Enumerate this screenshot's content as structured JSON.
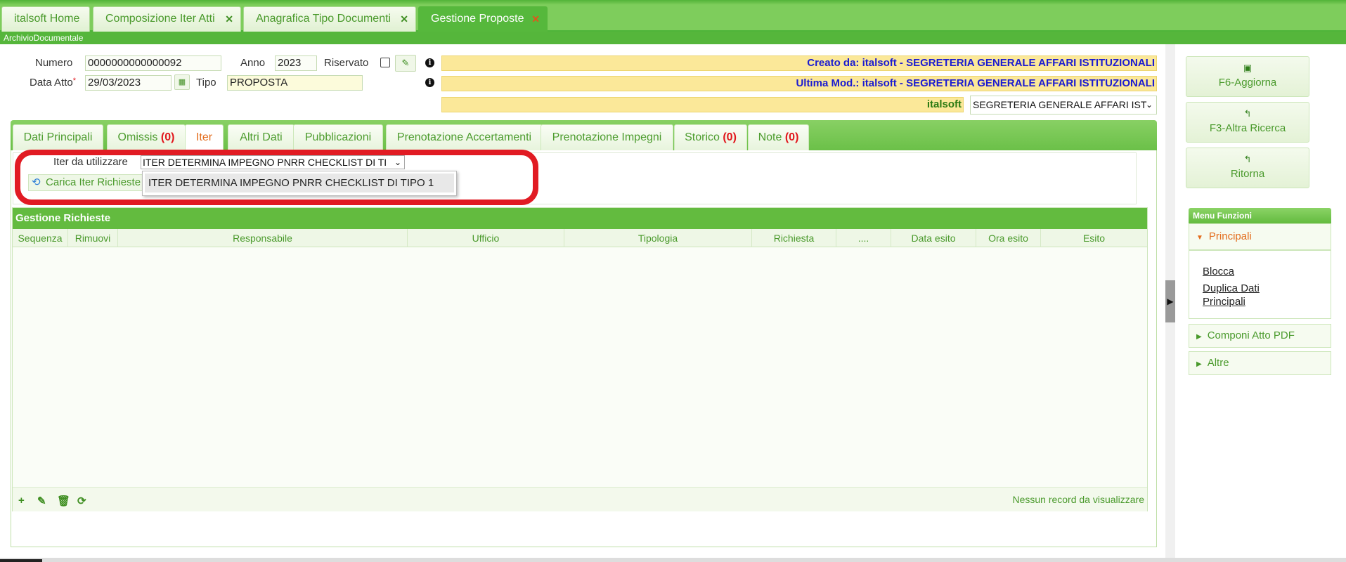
{
  "colors": {
    "accent": "#55b63b",
    "tab_active": "#56b83c",
    "count_red": "#e1151b",
    "highlight_ring": "#e11b23",
    "selected_tab": "#e36c1c"
  },
  "tabs": [
    {
      "label": "italsoft Home",
      "closable": false
    },
    {
      "label": "Composizione Iter Atti",
      "closable": true
    },
    {
      "label": "Anagrafica Tipo Documenti",
      "closable": true
    },
    {
      "label": "Gestione Proposte",
      "closable": true,
      "active": true
    }
  ],
  "close_glyph": "✕",
  "subbar": "ArchivioDocumentale",
  "form": {
    "numero_label": "Numero",
    "numero_value": "0000000000000092",
    "anno_label": "Anno",
    "anno_value": "2023",
    "riservato_label": "Riservato",
    "riservato_checked": false,
    "data_atto_label": "Data Atto",
    "required_mark": "*",
    "data_atto_value": "29/03/2023",
    "tipo_label": "Tipo",
    "tipo_value": "PROPOSTA"
  },
  "info_bars": {
    "created": "Creato da: italsoft - SEGRETERIA GENERALE AFFARI ISTITUZIONALI",
    "modified": "Ultima Mod.: italsoft - SEGRETERIA GENERALE AFFARI ISTITUZIONALI",
    "user": "italsoft",
    "office_select": "SEGRETERIA GENERALE AFFARI IST"
  },
  "inner_tabs": [
    {
      "label": "Dati Principali",
      "count": ""
    },
    {
      "label": "Omissis",
      "count": "(0)"
    },
    {
      "label": "Iter",
      "count": "",
      "selected": true
    },
    {
      "label": "Altri Dati",
      "count": ""
    },
    {
      "label": "Pubblicazioni",
      "count": ""
    },
    {
      "label": "Prenotazione Accertamenti",
      "count": ""
    },
    {
      "label": "Prenotazione Impegni",
      "count": ""
    },
    {
      "label": "Storico",
      "count": "(0)"
    },
    {
      "label": "Note",
      "count": "(0)"
    }
  ],
  "iter": {
    "label": "Iter da utilizzare",
    "selected_value": "ITER DETERMINA IMPEGNO PNRR CHECKLIST DI TI",
    "load_button": "Carica Iter Richieste",
    "dropdown_options": [
      "ITER DETERMINA IMPEGNO PNRR CHECKLIST DI TIPO 1"
    ]
  },
  "grid": {
    "title": "Gestione Richieste",
    "columns": [
      "Sequenza",
      "Rimuovi",
      "Responsabile",
      "Ufficio",
      "Tipologia",
      "Richiesta",
      "....",
      "Data esito",
      "Ora esito",
      "Esito"
    ],
    "rows": [],
    "footer_icons": [
      "add-icon",
      "edit-icon",
      "delete-icon",
      "refresh-icon"
    ],
    "empty_message": "Nessun record da visualizzare"
  },
  "side": {
    "buttons": [
      {
        "label": "F6-Aggiorna",
        "icon": "save-icon"
      },
      {
        "label": "F3-Altra Ricerca",
        "icon": "back-icon"
      },
      {
        "label": "Ritorna",
        "icon": "back-icon"
      }
    ],
    "menu_title": "Menu Funzioni",
    "sections": [
      {
        "label": "Principali",
        "expanded": true,
        "links": [
          "Blocca",
          "Duplica Dati Principali"
        ]
      },
      {
        "label": "Componi Atto PDF",
        "expanded": false
      },
      {
        "label": "Altre",
        "expanded": false
      }
    ]
  }
}
